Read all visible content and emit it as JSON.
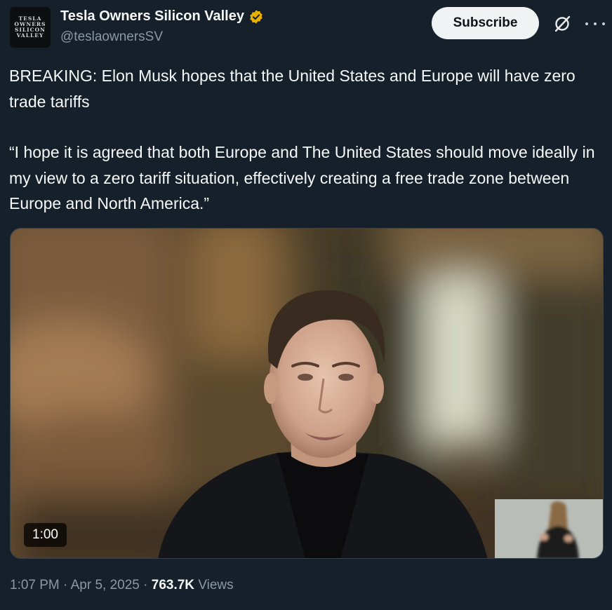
{
  "author": {
    "avatar_text": "TESLA\nOWNERS\nSILICON\nVALLEY",
    "display_name": "Tesla Owners Silicon Valley",
    "handle": "@teslaownersSV",
    "verified_badge_color": "#e8b000"
  },
  "actions": {
    "subscribe_label": "Subscribe",
    "grok_icon": "grok-icon",
    "more_icon": "more-icon"
  },
  "tweet": {
    "paragraph_1": "BREAKING: Elon Musk hopes that the United States and Europe will have zero trade tariffs",
    "paragraph_2": "“I hope it is agreed that both Europe and The United States should move ideally in my view to a zero tariff situation, effectively creating a free trade zone between Europe and North America.”"
  },
  "video": {
    "duration": "1:00"
  },
  "meta": {
    "time": "1:07 PM",
    "separator": "·",
    "date": "Apr 5, 2025",
    "views_count": "763.7K",
    "views_label": "Views"
  },
  "colors": {
    "background": "#15202b",
    "secondary_text": "#8b98a5",
    "primary_text": "#f7f9f9"
  }
}
